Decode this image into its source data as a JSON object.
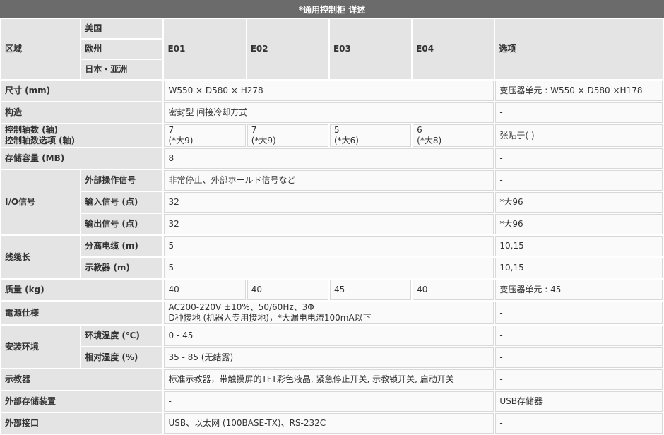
{
  "title": "*通用控制柜 详述",
  "header": {
    "region_label": "区域",
    "regions": [
      "美国",
      "欧州",
      "日本・亚洲"
    ],
    "models": [
      "E01",
      "E02",
      "E03",
      "E04"
    ],
    "options_label": "选项"
  },
  "rows": {
    "size": {
      "label": "尺寸 (mm)",
      "value": "W550 × D580 × H278",
      "option": "变压器单元 : W550 × D580 ×H178"
    },
    "structure": {
      "label": "构造",
      "value": "密封型 间接冷却方式",
      "option": "-"
    },
    "axes": {
      "label1": "控制轴数 (轴)",
      "label2": "控制轴数选项 (軸)",
      "values": [
        {
          "main": "7",
          "sub": "(*大9)"
        },
        {
          "main": "7",
          "sub": "(*大9)"
        },
        {
          "main": "5",
          "sub": "(*大6)"
        },
        {
          "main": "6",
          "sub": "(*大8)"
        }
      ],
      "option": "张贴于( )"
    },
    "memory": {
      "label": "存储容量 (MB)",
      "value": "8",
      "option": "-"
    },
    "io": {
      "label": "I/O信号",
      "ext": {
        "label": "外部操作信号",
        "value": "非常停止、外部ホールド信号など",
        "option": "-"
      },
      "input": {
        "label": "输入信号 (点)",
        "value": "32",
        "option": "*大96"
      },
      "output": {
        "label": "输出信号 (点)",
        "value": "32",
        "option": "*大96"
      }
    },
    "cable": {
      "label": "线缆长",
      "sep": {
        "label": "分离电缆 (m)",
        "value": "5",
        "option": "10,15"
      },
      "pendant": {
        "label": "示教器 (m)",
        "value": "5",
        "option": "10,15"
      }
    },
    "mass": {
      "label": "质量 (kg)",
      "values": [
        "40",
        "40",
        "45",
        "40"
      ],
      "option": "变压器单元 : 45"
    },
    "power": {
      "label": "電源仕様",
      "line1": "AC200-220V ±10%、50/60Hz、3Φ",
      "line2": "D种接地 (机器人专用接地)，*大漏电电流100mA以下",
      "option": "-"
    },
    "env": {
      "label": "安装环境",
      "temp": {
        "label": "环境温度 (℃)",
        "value": "0 - 45",
        "option": "-"
      },
      "humid": {
        "label": "相对湿度 (%)",
        "value": "35 - 85 (无结露)",
        "option": "-"
      }
    },
    "pendant": {
      "label": "示教器",
      "value": "标准示教器，带触摸屏的TFT彩色液晶, 紧急停止开关, 示教锁开关, 启动开关",
      "option": "-"
    },
    "ext_storage": {
      "label": "外部存储装置",
      "value": "-",
      "option": "USB存储器"
    },
    "interface": {
      "label": "外部接口",
      "value": "USB、以太网 (100BASE-TX)、RS-232C",
      "option": "-"
    }
  }
}
